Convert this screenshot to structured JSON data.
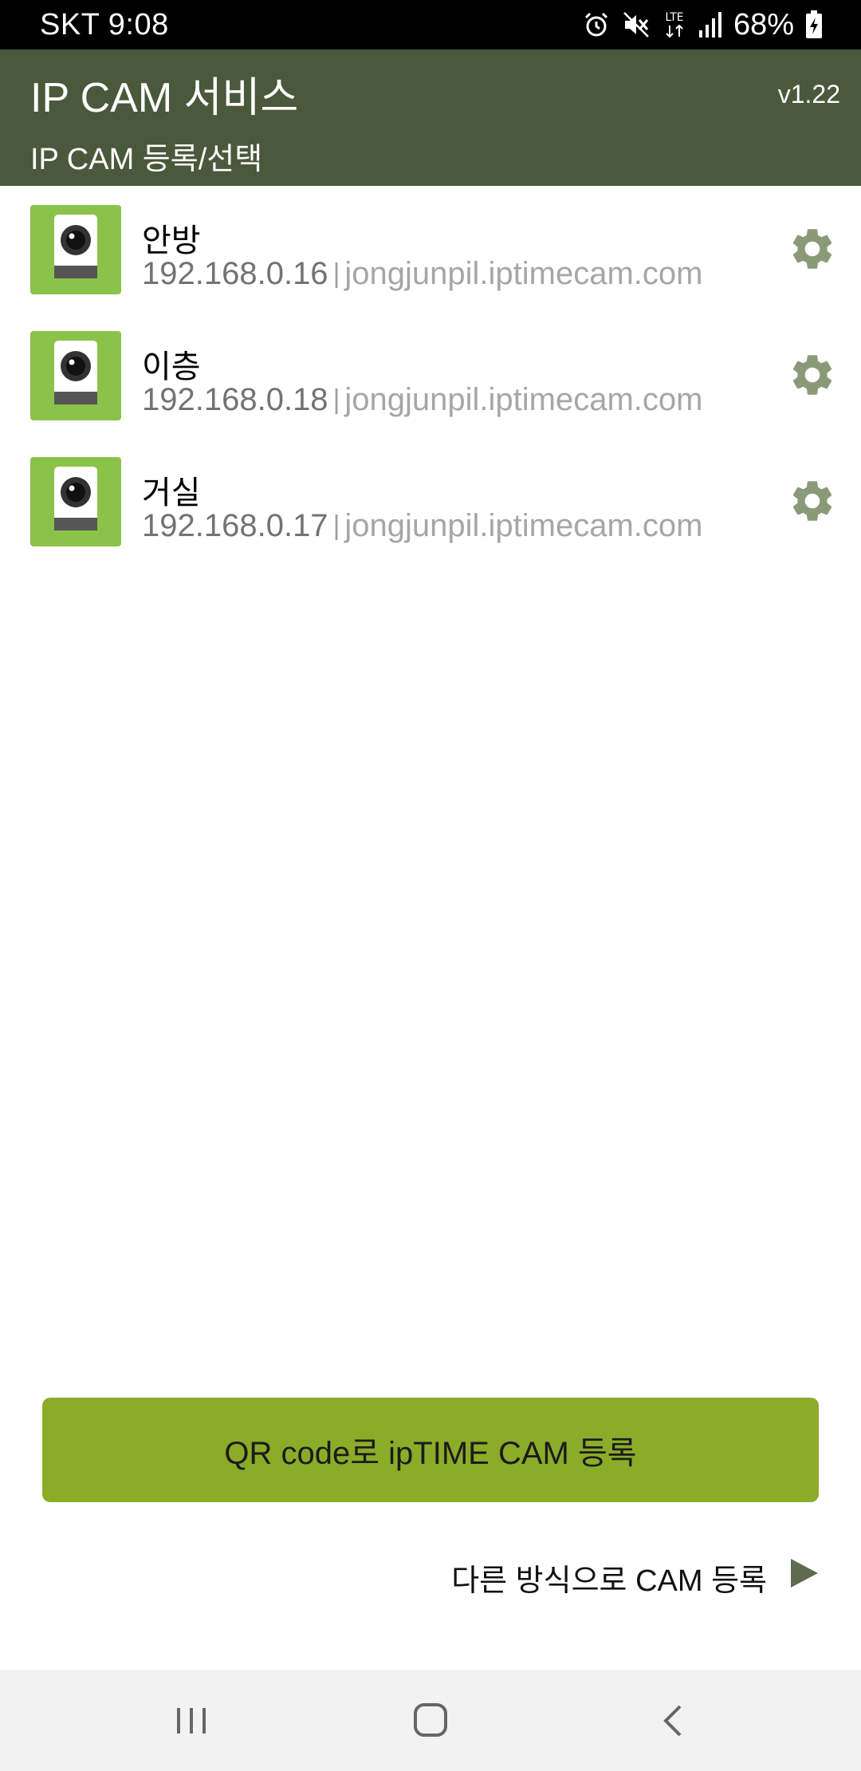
{
  "status_bar": {
    "carrier_time": "SKT 9:08",
    "network": "LTE",
    "battery": "68%",
    "icons": [
      "alarm-icon",
      "mute-icon",
      "lte-icon",
      "signal-icon",
      "battery-charging-icon"
    ]
  },
  "header": {
    "title": "IP CAM 서비스",
    "version": "v1.22",
    "subtitle": "IP CAM 등록/선택",
    "color": "#4a583b"
  },
  "cameras": [
    {
      "name": "안방",
      "ip": "192.168.0.16",
      "separator": "|",
      "host": "jongjunpil.iptimecam.com"
    },
    {
      "name": "이층",
      "ip": "192.168.0.18",
      "separator": "|",
      "host": "jongjunpil.iptimecam.com"
    },
    {
      "name": "거실",
      "ip": "192.168.0.17",
      "separator": "|",
      "host": "jongjunpil.iptimecam.com"
    }
  ],
  "actions": {
    "qr_button_label": "QR code로 ipTIME CAM 등록",
    "qr_button_color": "#8bac28",
    "other_method_label": "다른 방식으로 CAM 등록"
  },
  "nav_bar": {
    "icons": [
      "recent-apps-icon",
      "home-icon",
      "back-icon"
    ]
  }
}
